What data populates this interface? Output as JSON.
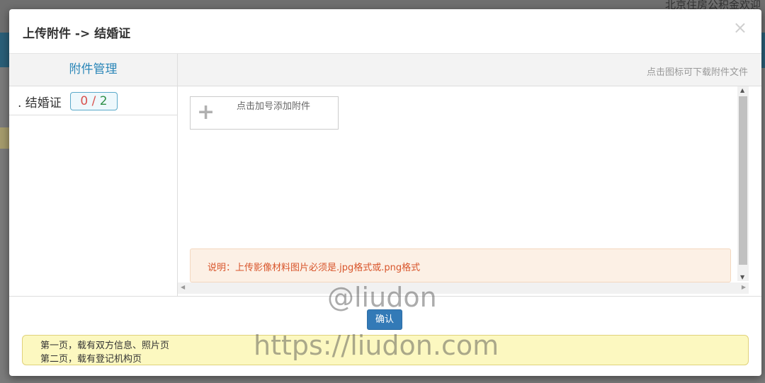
{
  "background": {
    "welcome_text": "北京住房公积金欢迎"
  },
  "modal": {
    "title": "上传附件 -> 结婚证",
    "close_glyph": "×"
  },
  "left_panel": {
    "header": "附件管理",
    "items": [
      {
        "label": ". 结婚证",
        "done": "0",
        "sep": " / ",
        "total": "2"
      }
    ]
  },
  "right_panel": {
    "download_hint": "点击图标可下载附件文件",
    "upload_label": "点击加号添加附件",
    "note": "说明：上传影像材料图片必须是.jpg格式或.png格式"
  },
  "footer": {
    "confirm_label": "确认",
    "tips": [
      "第一页，载有双方信息、照片页",
      "第二页，载有登记机构页"
    ]
  },
  "watermarks": [
    "@liudon",
    "https://liudon.com"
  ],
  "colors": {
    "accent": "#337ab7",
    "header_text": "#2a86b8",
    "note_text": "#d8552b",
    "tip_bg": "#fcf8c0"
  }
}
